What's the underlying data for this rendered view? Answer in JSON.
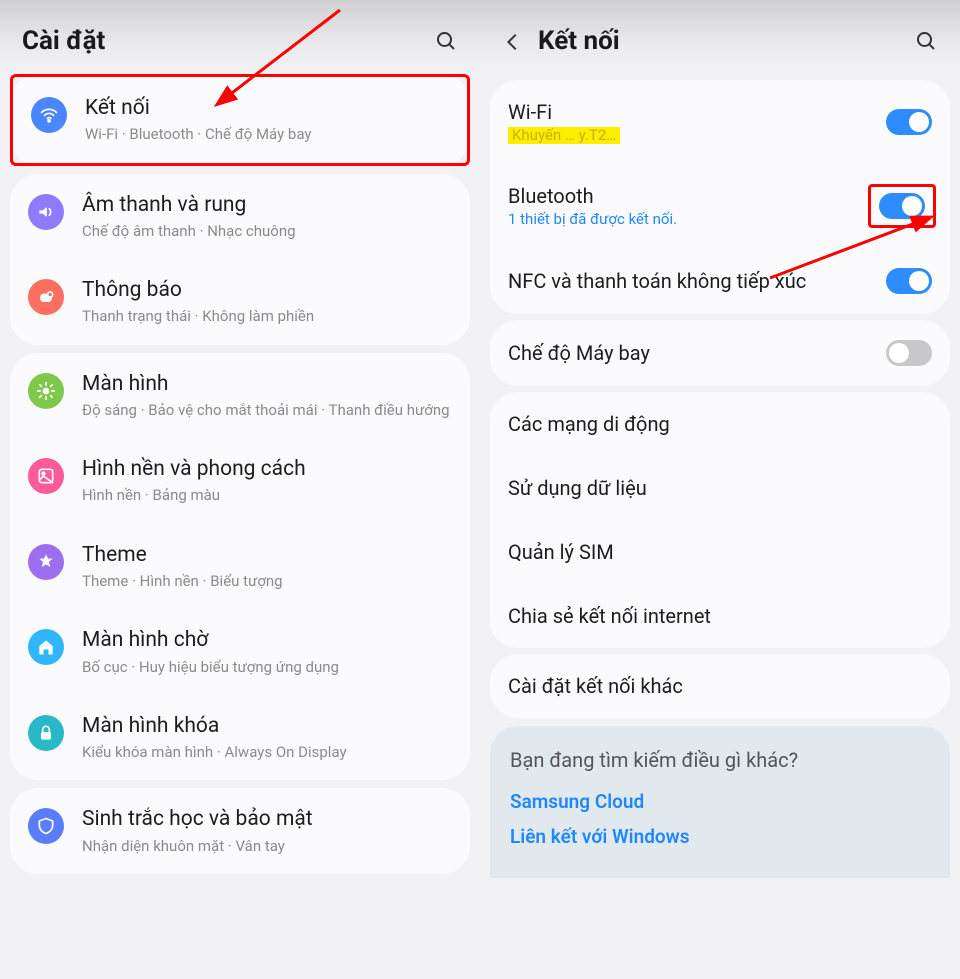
{
  "left": {
    "title": "Cài đặt",
    "groups": [
      [
        {
          "icon": "wifi",
          "color": "#4a86ff",
          "title": "Kết nối",
          "sub": "Wi-Fi  ·  Bluetooth  ·  Chế độ Máy bay",
          "highlight": true
        }
      ],
      [
        {
          "icon": "sound",
          "color": "#8f7bff",
          "title": "Âm thanh và rung",
          "sub": "Chế độ âm thanh  ·  Nhạc chuông"
        },
        {
          "icon": "notif",
          "color": "#ff6f61",
          "title": "Thông báo",
          "sub": "Thanh trạng thái  ·  Không làm phiền"
        }
      ],
      [
        {
          "icon": "display",
          "color": "#7fc94a",
          "title": "Màn hình",
          "sub": "Độ sáng  ·  Bảo vệ cho mắt thoải mái  ·  Thanh điều hướng"
        },
        {
          "icon": "wall",
          "color": "#ff5a9a",
          "title": "Hình nền và phong cách",
          "sub": "Hình nền  ·  Bảng màu"
        },
        {
          "icon": "theme",
          "color": "#9b6ff0",
          "title": "Theme",
          "sub": "Theme  ·  Hình nền  ·  Biểu tượng"
        },
        {
          "icon": "home",
          "color": "#2fb6ff",
          "title": "Màn hình chờ",
          "sub": "Bố cục  ·  Huy hiệu biểu tượng ứng dụng"
        },
        {
          "icon": "lock",
          "color": "#29b9c6",
          "title": "Màn hình khóa",
          "sub": "Kiểu khóa màn hình  ·  Always On Display"
        }
      ],
      [
        {
          "icon": "shield",
          "color": "#5a7dff",
          "title": "Sinh trắc học và bảo mật",
          "sub": "Nhận diện khuôn mặt  ·  Vân tay"
        }
      ]
    ]
  },
  "right": {
    "title": "Kết nối",
    "rows1": [
      {
        "title": "Wi-Fi",
        "sub": "Khuyến … y.T2…",
        "subHighlighted": true,
        "toggle": "on"
      },
      {
        "title": "Bluetooth",
        "sub": "1 thiết bị đã được kết nối.",
        "subBlue": true,
        "toggle": "on",
        "toggleBoxed": true
      },
      {
        "title": "NFC và thanh toán không tiếp xúc",
        "toggle": "on"
      }
    ],
    "rows2": [
      {
        "title": "Chế độ Máy bay",
        "toggle": "off"
      }
    ],
    "rows3": [
      {
        "title": "Các mạng di động"
      },
      {
        "title": "Sử dụng dữ liệu"
      },
      {
        "title": "Quản lý SIM"
      },
      {
        "title": "Chia sẻ kết nối internet"
      }
    ],
    "rows4": [
      {
        "title": "Cài đặt kết nối khác"
      }
    ],
    "footer": {
      "question": "Bạn đang tìm kiếm điều gì khác?",
      "links": [
        "Samsung Cloud",
        "Liên kết với Windows"
      ]
    }
  }
}
